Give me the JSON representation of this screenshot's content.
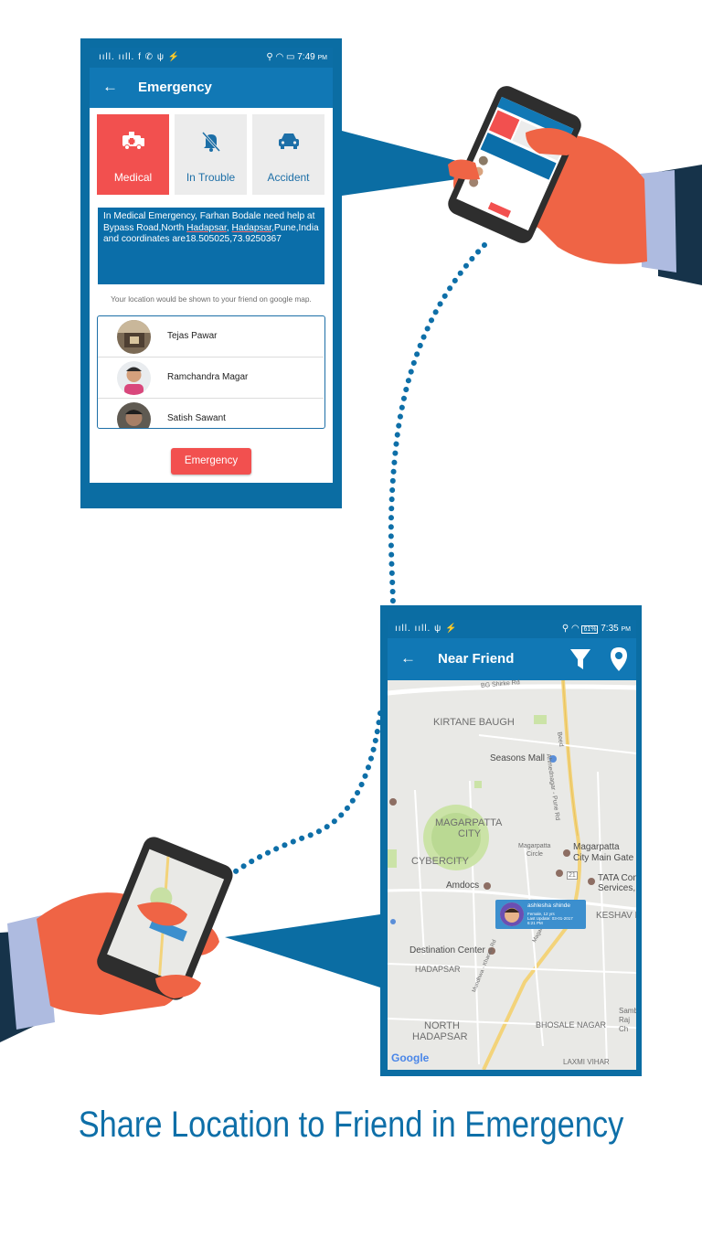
{
  "screen1": {
    "status_left": "ııll. ııll. f ✆ ψ ⚡",
    "status_time": "7:49",
    "status_ampm": "PM",
    "title": "Emergency",
    "categories": [
      {
        "label": "Medical",
        "icon": "ambulance-icon",
        "selected": true
      },
      {
        "label": "In Trouble",
        "icon": "bell-off-icon",
        "selected": false
      },
      {
        "label": "Accident",
        "icon": "car-icon",
        "selected": false
      }
    ],
    "message_prefix": "In Medical Emergency, Farhan Bodale need help at Bypass Road,North ",
    "message_hl1": "Hadapsar",
    "message_sep": ", ",
    "message_hl2": "Hadapsar",
    "message_suffix": ",Pune,India and coordinates are18.505025,73.9250367",
    "info_text": "Your location would be shown to your friend on google map.",
    "friends": [
      {
        "name": "Tejas Pawar"
      },
      {
        "name": "Ramchandra Magar"
      },
      {
        "name": "Satish Sawant"
      }
    ],
    "button_label": "Emergency",
    "colors": {
      "primary": "#1178b5",
      "accent": "#f2504f"
    }
  },
  "screen2": {
    "status_time": "7:35",
    "status_ampm": "PM",
    "battery": "61%",
    "title": "Near Friend",
    "map_labels": {
      "road_top": "BG Shirke Rd",
      "kirtane": "KIRTANE BAUGH",
      "seasons": "Seasons Mall",
      "magarpatta1": "MAGARPATTA",
      "magarpatta2": "CITY",
      "cybercity": "CYBERCITY",
      "circle1": "Magarpatta",
      "circle2": "Circle",
      "citygate1": "Magarpatta",
      "citygate2": "City Main Gate",
      "amdocs": "Amdocs",
      "tata1": "TATA Con",
      "tata2": "Services,",
      "keshav": "KESHAV NA",
      "destination": "Destination Center",
      "hadapsar": "HADAPSAR",
      "north1": "NORTH",
      "north2": "HADAPSAR",
      "bhosale": "BHOSALE NAGAR",
      "laxmi": "LAXMI VIHAR",
      "sambh": "Samb",
      "raj": "Raj",
      "ch": "Ch",
      "road_highway": "Ahmednagar - Pune Rd",
      "road_beed": "Beed",
      "road_solapur": "Magarpatta Rd",
      "road_mundhwa": "Mundhwa - Kharadi Rd",
      "num_21": "21",
      "google": "Google"
    },
    "friend_card": {
      "name": "ashlesha shinde",
      "line1": "Female, 12 yrs",
      "line2": "Last Update: 03-01-2017",
      "line3": "6:21 PM"
    }
  },
  "tagline": "Share Location to Friend in Emergency"
}
